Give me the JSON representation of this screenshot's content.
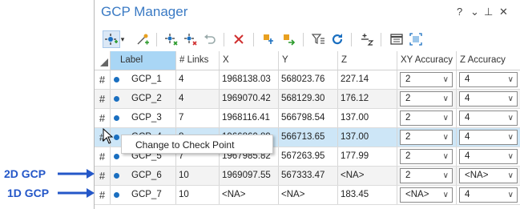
{
  "window": {
    "title": "GCP Manager",
    "controls": [
      "?",
      "⌄",
      "⊥",
      "✕"
    ]
  },
  "toolbar": {
    "icons": [
      "add-gcp-icon",
      "dropdown-chevron-icon",
      "add-point-icon",
      "select-points-icon",
      "delete-points-icon",
      "undo-icon",
      "delete-icon",
      "import-icon",
      "export-icon",
      "filter-icon",
      "refresh-icon",
      "sort-icon",
      "table-view-icon",
      "zoom-extent-icon"
    ]
  },
  "columns": [
    "Label",
    "# Links",
    "X",
    "Y",
    "Z",
    "XY Accuracy",
    "Z Accuracy"
  ],
  "rows": [
    {
      "mark": "#",
      "label": "GCP_1",
      "links": "4",
      "x": "1968138.03",
      "y": "568023.76",
      "z": "227.14",
      "xy_acc": "2",
      "z_acc": "4",
      "style": "even"
    },
    {
      "mark": "#",
      "label": "GCP_2",
      "links": "4",
      "x": "1969070.42",
      "y": "568129.30",
      "z": "176.12",
      "xy_acc": "2",
      "z_acc": "4",
      "style": "odd"
    },
    {
      "mark": "#",
      "label": "GCP_3",
      "links": "7",
      "x": "1968116.41",
      "y": "566798.54",
      "z": "137.00",
      "xy_acc": "2",
      "z_acc": "4",
      "style": "even"
    },
    {
      "mark": "#",
      "label": "GCP_4",
      "links": "8",
      "x": "1966860.89",
      "y": "566713.65",
      "z": "137.00",
      "xy_acc": "2",
      "z_acc": "4",
      "style": "sel"
    },
    {
      "mark": "#",
      "label": "GCP_5",
      "links": "7",
      "x": "1967985.82",
      "y": "567263.95",
      "z": "177.99",
      "xy_acc": "2",
      "z_acc": "4",
      "style": "even"
    },
    {
      "mark": "#",
      "label": "GCP_6",
      "links": "10",
      "x": "1969097.55",
      "y": "567333.47",
      "z": "<NA>",
      "xy_acc": "2",
      "z_acc": "<NA>",
      "style": "odd"
    },
    {
      "mark": "#",
      "label": "GCP_7",
      "links": "10",
      "x": "<NA>",
      "y": "<NA>",
      "z": "183.45",
      "xy_acc": "<NA>",
      "z_acc": "4",
      "style": "even"
    }
  ],
  "context_menu": {
    "item": "Change to Check Point"
  },
  "annotations": {
    "gcp2d": "2D GCP",
    "gcp1d": "1D GCP"
  },
  "colors": {
    "title": "#3a7ac4",
    "label_header": "#a9d6f5",
    "selected_row": "#cde6f7",
    "annotation": "#2457c8",
    "point_dot": "#1a6fc0"
  }
}
